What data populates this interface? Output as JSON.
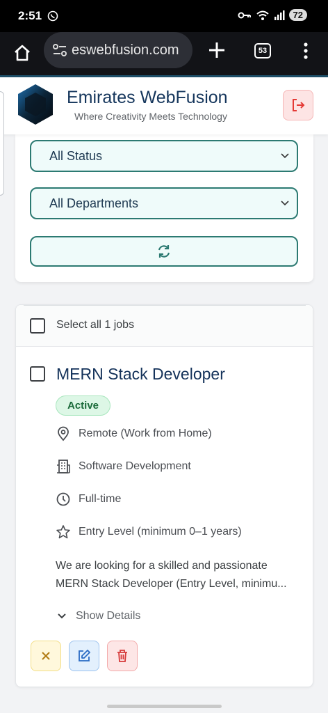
{
  "status_bar": {
    "time": "2:51",
    "battery": "72"
  },
  "browser": {
    "url": "eswebfusion.com",
    "tab_count": "53"
  },
  "header": {
    "brand": "Emirates WebFusion",
    "tagline": "Where Creativity Meets Technology"
  },
  "filters": {
    "status_select": "All Status",
    "department_select": "All Departments"
  },
  "jobs": {
    "select_all_label": "Select all 1 jobs",
    "items": [
      {
        "title": "MERN Stack Developer",
        "status": "Active",
        "location": "Remote (Work from Home)",
        "department": "Software Development",
        "type": "Full-time",
        "level": "Entry Level (minimum 0–1 years)",
        "description_line1": "We are looking for a skilled and passionate",
        "description_line2": "MERN Stack Developer (Entry Level, minimu...",
        "show_details": "Show Details"
      }
    ]
  },
  "colors": {
    "brand": "#15365c",
    "accent": "#2c7a72",
    "active_badge": "#ddf7e6",
    "logout": "#e53935"
  },
  "icons": [
    "whatsapp-icon",
    "key-icon",
    "wifi-icon",
    "signal-icon",
    "home-icon",
    "tune-icon",
    "plus-icon",
    "more-icon",
    "logout-icon",
    "chevron-down-icon",
    "refresh-icon",
    "location-pin-icon",
    "building-icon",
    "clock-icon",
    "star-icon",
    "close-icon",
    "edit-icon",
    "trash-icon"
  ]
}
